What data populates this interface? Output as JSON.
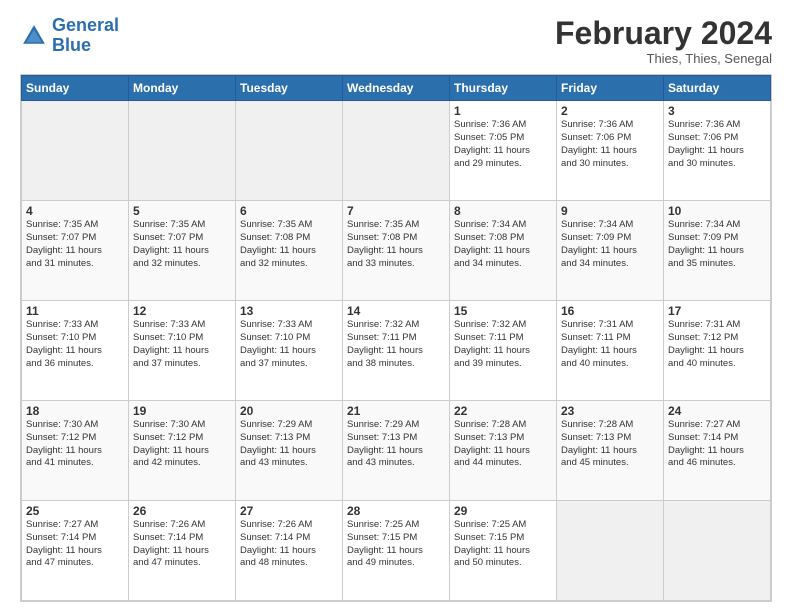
{
  "logo": {
    "line1": "General",
    "line2": "Blue"
  },
  "header": {
    "month": "February 2024",
    "location": "Thies, Thies, Senegal"
  },
  "weekdays": [
    "Sunday",
    "Monday",
    "Tuesday",
    "Wednesday",
    "Thursday",
    "Friday",
    "Saturday"
  ],
  "weeks": [
    [
      {
        "day": "",
        "info": ""
      },
      {
        "day": "",
        "info": ""
      },
      {
        "day": "",
        "info": ""
      },
      {
        "day": "",
        "info": ""
      },
      {
        "day": "1",
        "info": "Sunrise: 7:36 AM\nSunset: 7:05 PM\nDaylight: 11 hours\nand 29 minutes."
      },
      {
        "day": "2",
        "info": "Sunrise: 7:36 AM\nSunset: 7:06 PM\nDaylight: 11 hours\nand 30 minutes."
      },
      {
        "day": "3",
        "info": "Sunrise: 7:36 AM\nSunset: 7:06 PM\nDaylight: 11 hours\nand 30 minutes."
      }
    ],
    [
      {
        "day": "4",
        "info": "Sunrise: 7:35 AM\nSunset: 7:07 PM\nDaylight: 11 hours\nand 31 minutes."
      },
      {
        "day": "5",
        "info": "Sunrise: 7:35 AM\nSunset: 7:07 PM\nDaylight: 11 hours\nand 32 minutes."
      },
      {
        "day": "6",
        "info": "Sunrise: 7:35 AM\nSunset: 7:08 PM\nDaylight: 11 hours\nand 32 minutes."
      },
      {
        "day": "7",
        "info": "Sunrise: 7:35 AM\nSunset: 7:08 PM\nDaylight: 11 hours\nand 33 minutes."
      },
      {
        "day": "8",
        "info": "Sunrise: 7:34 AM\nSunset: 7:08 PM\nDaylight: 11 hours\nand 34 minutes."
      },
      {
        "day": "9",
        "info": "Sunrise: 7:34 AM\nSunset: 7:09 PM\nDaylight: 11 hours\nand 34 minutes."
      },
      {
        "day": "10",
        "info": "Sunrise: 7:34 AM\nSunset: 7:09 PM\nDaylight: 11 hours\nand 35 minutes."
      }
    ],
    [
      {
        "day": "11",
        "info": "Sunrise: 7:33 AM\nSunset: 7:10 PM\nDaylight: 11 hours\nand 36 minutes."
      },
      {
        "day": "12",
        "info": "Sunrise: 7:33 AM\nSunset: 7:10 PM\nDaylight: 11 hours\nand 37 minutes."
      },
      {
        "day": "13",
        "info": "Sunrise: 7:33 AM\nSunset: 7:10 PM\nDaylight: 11 hours\nand 37 minutes."
      },
      {
        "day": "14",
        "info": "Sunrise: 7:32 AM\nSunset: 7:11 PM\nDaylight: 11 hours\nand 38 minutes."
      },
      {
        "day": "15",
        "info": "Sunrise: 7:32 AM\nSunset: 7:11 PM\nDaylight: 11 hours\nand 39 minutes."
      },
      {
        "day": "16",
        "info": "Sunrise: 7:31 AM\nSunset: 7:11 PM\nDaylight: 11 hours\nand 40 minutes."
      },
      {
        "day": "17",
        "info": "Sunrise: 7:31 AM\nSunset: 7:12 PM\nDaylight: 11 hours\nand 40 minutes."
      }
    ],
    [
      {
        "day": "18",
        "info": "Sunrise: 7:30 AM\nSunset: 7:12 PM\nDaylight: 11 hours\nand 41 minutes."
      },
      {
        "day": "19",
        "info": "Sunrise: 7:30 AM\nSunset: 7:12 PM\nDaylight: 11 hours\nand 42 minutes."
      },
      {
        "day": "20",
        "info": "Sunrise: 7:29 AM\nSunset: 7:13 PM\nDaylight: 11 hours\nand 43 minutes."
      },
      {
        "day": "21",
        "info": "Sunrise: 7:29 AM\nSunset: 7:13 PM\nDaylight: 11 hours\nand 43 minutes."
      },
      {
        "day": "22",
        "info": "Sunrise: 7:28 AM\nSunset: 7:13 PM\nDaylight: 11 hours\nand 44 minutes."
      },
      {
        "day": "23",
        "info": "Sunrise: 7:28 AM\nSunset: 7:13 PM\nDaylight: 11 hours\nand 45 minutes."
      },
      {
        "day": "24",
        "info": "Sunrise: 7:27 AM\nSunset: 7:14 PM\nDaylight: 11 hours\nand 46 minutes."
      }
    ],
    [
      {
        "day": "25",
        "info": "Sunrise: 7:27 AM\nSunset: 7:14 PM\nDaylight: 11 hours\nand 47 minutes."
      },
      {
        "day": "26",
        "info": "Sunrise: 7:26 AM\nSunset: 7:14 PM\nDaylight: 11 hours\nand 47 minutes."
      },
      {
        "day": "27",
        "info": "Sunrise: 7:26 AM\nSunset: 7:14 PM\nDaylight: 11 hours\nand 48 minutes."
      },
      {
        "day": "28",
        "info": "Sunrise: 7:25 AM\nSunset: 7:15 PM\nDaylight: 11 hours\nand 49 minutes."
      },
      {
        "day": "29",
        "info": "Sunrise: 7:25 AM\nSunset: 7:15 PM\nDaylight: 11 hours\nand 50 minutes."
      },
      {
        "day": "",
        "info": ""
      },
      {
        "day": "",
        "info": ""
      }
    ]
  ]
}
